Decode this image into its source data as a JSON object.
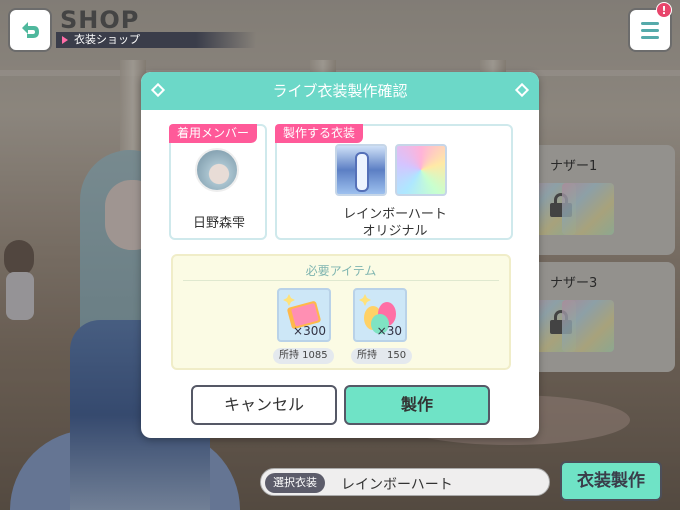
{
  "header": {
    "title": "SHOP",
    "subtitle": "衣装ショップ",
    "menu_badge": "!"
  },
  "background_list": {
    "cards": [
      {
        "label": "ナザー1"
      },
      {
        "label": "ナザー3"
      }
    ]
  },
  "bottom_bar": {
    "selected_tag": "選択衣装",
    "selected_value": "レインボーハート",
    "make_button": "衣装製作"
  },
  "dialog": {
    "title": "ライブ衣装製作確認",
    "member_section": {
      "tag": "着用メンバー",
      "member_name": "日野森雫"
    },
    "costume_section": {
      "tag": "製作する衣装",
      "costume_name_line1": "レインボーハート",
      "costume_name_line2": "オリジナル"
    },
    "required_items": {
      "title": "必要アイテム",
      "items": [
        {
          "quantity": "×300",
          "owned": "所持 1085",
          "icon": "ticket-material-icon"
        },
        {
          "quantity": "×30",
          "owned": "所持　150",
          "icon": "thread-spool-icon"
        }
      ]
    },
    "cancel_button": "キャンセル",
    "confirm_button": "製作"
  },
  "colors": {
    "accent_teal": "#6cd8c8",
    "tag_pink": "#ff5a99",
    "button_mint": "#6fe3c6"
  }
}
